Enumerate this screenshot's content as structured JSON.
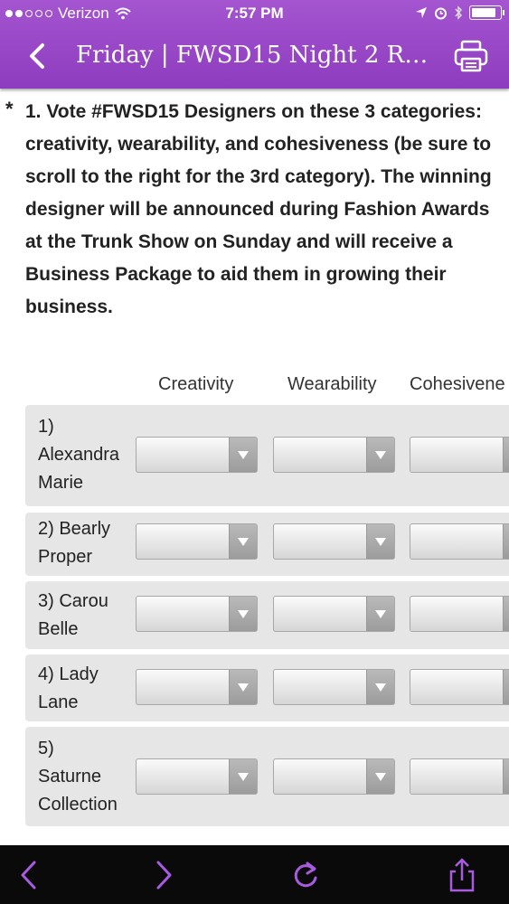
{
  "status": {
    "carrier": "Verizon",
    "time": "7:57 PM"
  },
  "nav": {
    "title": "Friday | FWSD15 Night 2 Ru..."
  },
  "question": {
    "asterisk": "*",
    "text": "1. Vote #FWSD15 Designers on these 3 categories: creativity, wearability, and cohesiveness (be sure to scroll to the right for the 3rd category). The winning designer will be announced during Fashion Awards at the Trunk Show on Sunday and will receive a Business Package to aid them in growing their business."
  },
  "columns": [
    "Creativity",
    "Wearability",
    "Cohesivene"
  ],
  "rows": [
    {
      "label_lines": [
        "1)",
        "Alexandra",
        "Marie"
      ]
    },
    {
      "label_lines": [
        "2) Bearly",
        "Proper"
      ]
    },
    {
      "label_lines": [
        "3) Carou",
        "Belle"
      ]
    },
    {
      "label_lines": [
        "4) Lady",
        "Lane"
      ]
    },
    {
      "label_lines": [
        "5)",
        "Saturne",
        "Collection"
      ]
    }
  ],
  "icons": {
    "back": "chevron-left-icon",
    "print": "printer-icon",
    "toolbar": [
      "back-arrow-icon",
      "forward-arrow-icon",
      "reload-icon",
      "share-icon"
    ]
  },
  "colors": {
    "accent": "#9a47c9",
    "toolbar_icon": "#a95be0"
  }
}
